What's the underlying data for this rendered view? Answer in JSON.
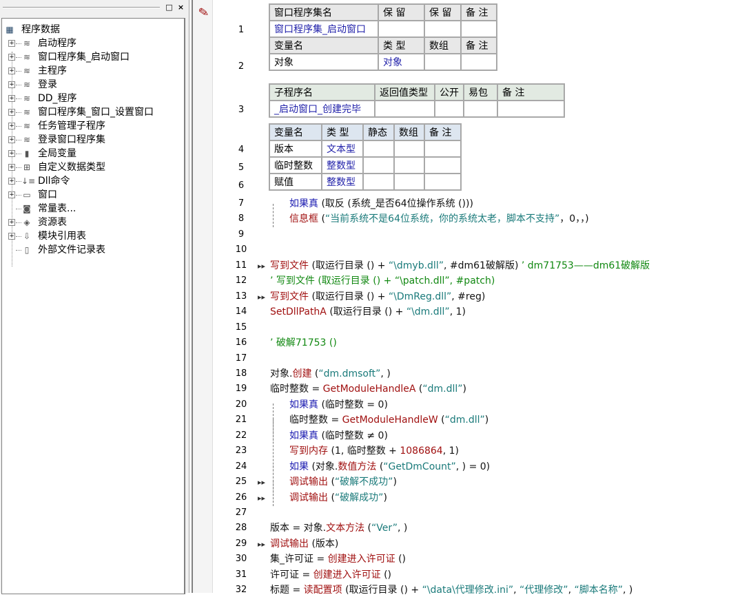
{
  "panel": {
    "tree": [
      {
        "label": "程序数据",
        "icon": "program-data-icon",
        "root": true
      },
      {
        "label": "启动程序",
        "icon": "module-icon"
      },
      {
        "label": "窗口程序集_启动窗口",
        "icon": "module-icon"
      },
      {
        "label": "主程序",
        "icon": "module-icon"
      },
      {
        "label": "登录",
        "icon": "module-icon"
      },
      {
        "label": "DD_程序",
        "icon": "module-icon"
      },
      {
        "label": "窗口程序集_窗口_设置窗口",
        "icon": "module-icon"
      },
      {
        "label": "任务管理子程序",
        "icon": "module-icon"
      },
      {
        "label": "登录窗口程序集",
        "icon": "module-icon"
      },
      {
        "label": "全局变量",
        "icon": "database-icon"
      },
      {
        "label": "自定义数据类型",
        "icon": "data-type-icon"
      },
      {
        "label": "Dll命令",
        "icon": "dll-icon"
      },
      {
        "label": "窗口",
        "icon": "window-icon"
      },
      {
        "label": "常量表...",
        "icon": "constant-icon",
        "leaf": true
      },
      {
        "label": "资源表",
        "icon": "resource-icon"
      },
      {
        "label": "模块引用表",
        "icon": "module-ref-icon"
      },
      {
        "label": "外部文件记录表",
        "icon": "file-icon",
        "leaf": true
      }
    ]
  },
  "table1": {
    "headers": [
      "窗口程序集名",
      "保 留",
      "保 留",
      "备 注"
    ],
    "row": [
      "窗口程序集_启动窗口",
      "",
      "",
      ""
    ],
    "var_headers": [
      "变量名",
      "类 型",
      "数组",
      "备 注"
    ],
    "var_row": [
      "对象",
      "对象",
      "",
      ""
    ]
  },
  "table2": {
    "headers": [
      "子程序名",
      "返回值类型",
      "公开",
      "易包",
      "备 注"
    ],
    "row": [
      "_启动窗口_创建完毕",
      "",
      "",
      "",
      ""
    ]
  },
  "table3": {
    "headers": [
      "变量名",
      "类 型",
      "静态",
      "数组",
      "备 注"
    ],
    "rows": [
      [
        "版本",
        "文本型",
        "",
        "",
        ""
      ],
      [
        "临时整数",
        "整数型",
        "",
        "",
        ""
      ],
      [
        "赋值",
        "整数型",
        "",
        "",
        ""
      ]
    ]
  },
  "line_numbers": {
    "t1": "1",
    "t2": "2",
    "t3": "3",
    "t4": "4",
    "t5": "5",
    "t6": "6"
  },
  "code": [
    {
      "n": "7",
      "seg": [
        [
          "如果真",
          "k"
        ],
        [
          " (取反 (系统_是否64位操作系统 ()))",
          "n"
        ]
      ]
    },
    {
      "n": "8",
      "seg": [
        [
          "信息框",
          "f"
        ],
        [
          " (",
          "n"
        ],
        [
          "“当前系统不是64位系统，你的系统太老，脚本不支持”",
          "s"
        ],
        [
          "，0，，)",
          "n"
        ]
      ]
    },
    {
      "n": "9",
      "seg": []
    },
    {
      "n": "10",
      "seg": []
    },
    {
      "n": "11",
      "seg": [
        [
          "写到文件",
          "f"
        ],
        [
          " (取运行目录 () + ",
          "n"
        ],
        [
          "“\\dmyb.dll”",
          "s"
        ],
        [
          ", #dm61破解版) ",
          "n"
        ],
        [
          "’ dm71753——dm61破解版",
          "c"
        ]
      ]
    },
    {
      "n": "12",
      "seg": [
        [
          "’ 写到文件 (取运行目录 () + “\\patch.dll”, #patch)",
          "c"
        ]
      ]
    },
    {
      "n": "13",
      "seg": [
        [
          "写到文件",
          "f"
        ],
        [
          " (取运行目录 () + ",
          "n"
        ],
        [
          "“\\DmReg.dll”",
          "s"
        ],
        [
          ", #reg)",
          "n"
        ]
      ]
    },
    {
      "n": "14",
      "seg": [
        [
          "SetDllPathA",
          "f"
        ],
        [
          " (取运行目录 () + ",
          "n"
        ],
        [
          "“\\dm.dll”",
          "s"
        ],
        [
          ", 1)",
          "n"
        ]
      ]
    },
    {
      "n": "15",
      "seg": []
    },
    {
      "n": "16",
      "seg": [
        [
          "’ 破解71753 ()",
          "c"
        ]
      ]
    },
    {
      "n": "17",
      "seg": []
    },
    {
      "n": "18",
      "seg": [
        [
          "对象.",
          "n"
        ],
        [
          "创建",
          "f"
        ],
        [
          " (",
          "n"
        ],
        [
          "“dm.dmsoft”",
          "s"
        ],
        [
          ", )",
          "n"
        ]
      ]
    },
    {
      "n": "19",
      "seg": [
        [
          "临时整数 = ",
          "n"
        ],
        [
          "GetModuleHandleA",
          "f"
        ],
        [
          " (",
          "n"
        ],
        [
          "“dm.dll”",
          "s"
        ],
        [
          ")",
          "n"
        ]
      ]
    },
    {
      "n": "20",
      "seg": [
        [
          "如果真",
          "k"
        ],
        [
          " (临时整数 = 0)",
          "n"
        ]
      ]
    },
    {
      "n": "21",
      "seg": [
        [
          "临时整数 = ",
          "n"
        ],
        [
          "GetModuleHandleW",
          "f"
        ],
        [
          " (",
          "n"
        ],
        [
          "“dm.dll”",
          "s"
        ],
        [
          ")",
          "n"
        ]
      ]
    },
    {
      "n": "22",
      "seg": [
        [
          "如果真",
          "k"
        ],
        [
          " (临时整数 ≠ 0)",
          "n"
        ]
      ]
    },
    {
      "n": "23",
      "seg": [
        [
          "写到内存",
          "f"
        ],
        [
          " (1, 临时整数 + ",
          "n"
        ],
        [
          "1086864",
          "f"
        ],
        [
          ", 1)",
          "n"
        ]
      ]
    },
    {
      "n": "24",
      "seg": [
        [
          "如果",
          "k"
        ],
        [
          " (对象.",
          "n"
        ],
        [
          "数值方法",
          "f"
        ],
        [
          " (",
          "n"
        ],
        [
          "“GetDmCount”",
          "s"
        ],
        [
          ", ) = 0)",
          "n"
        ]
      ]
    },
    {
      "n": "25",
      "seg": [
        [
          "调试输出",
          "f"
        ],
        [
          " (",
          "n"
        ],
        [
          "“破解不成功”",
          "s"
        ],
        [
          ")",
          "n"
        ]
      ]
    },
    {
      "n": "26",
      "seg": [
        [
          "调试输出",
          "f"
        ],
        [
          " (",
          "n"
        ],
        [
          "“破解成功”",
          "s"
        ],
        [
          ")",
          "n"
        ]
      ]
    },
    {
      "n": "27",
      "seg": []
    },
    {
      "n": "28",
      "seg": [
        [
          "版本 = 对象.",
          "n"
        ],
        [
          "文本方法",
          "f"
        ],
        [
          " (",
          "n"
        ],
        [
          "“Ver”",
          "s"
        ],
        [
          ", )",
          "n"
        ]
      ]
    },
    {
      "n": "29",
      "seg": [
        [
          "调试输出",
          "f"
        ],
        [
          " (版本)",
          "n"
        ]
      ]
    },
    {
      "n": "30",
      "seg": [
        [
          "集_许可证 = ",
          "n"
        ],
        [
          "创建进入许可证",
          "f"
        ],
        [
          " ()",
          "n"
        ]
      ]
    },
    {
      "n": "31",
      "seg": [
        [
          "许可证 = ",
          "n"
        ],
        [
          "创建进入许可证",
          "f"
        ],
        [
          " ()",
          "n"
        ]
      ]
    },
    {
      "n": "32",
      "seg": [
        [
          "标题 = ",
          "n"
        ],
        [
          "读配置项",
          "f"
        ],
        [
          " (取运行目录 () + ",
          "n"
        ],
        [
          "“\\data\\代理修改.ini”",
          "s"
        ],
        [
          ", ",
          "n"
        ],
        [
          "“代理修改”",
          "s"
        ],
        [
          ", ",
          "n"
        ],
        [
          "“脚本名称”",
          "s"
        ],
        [
          ", )",
          "n"
        ]
      ]
    }
  ]
}
